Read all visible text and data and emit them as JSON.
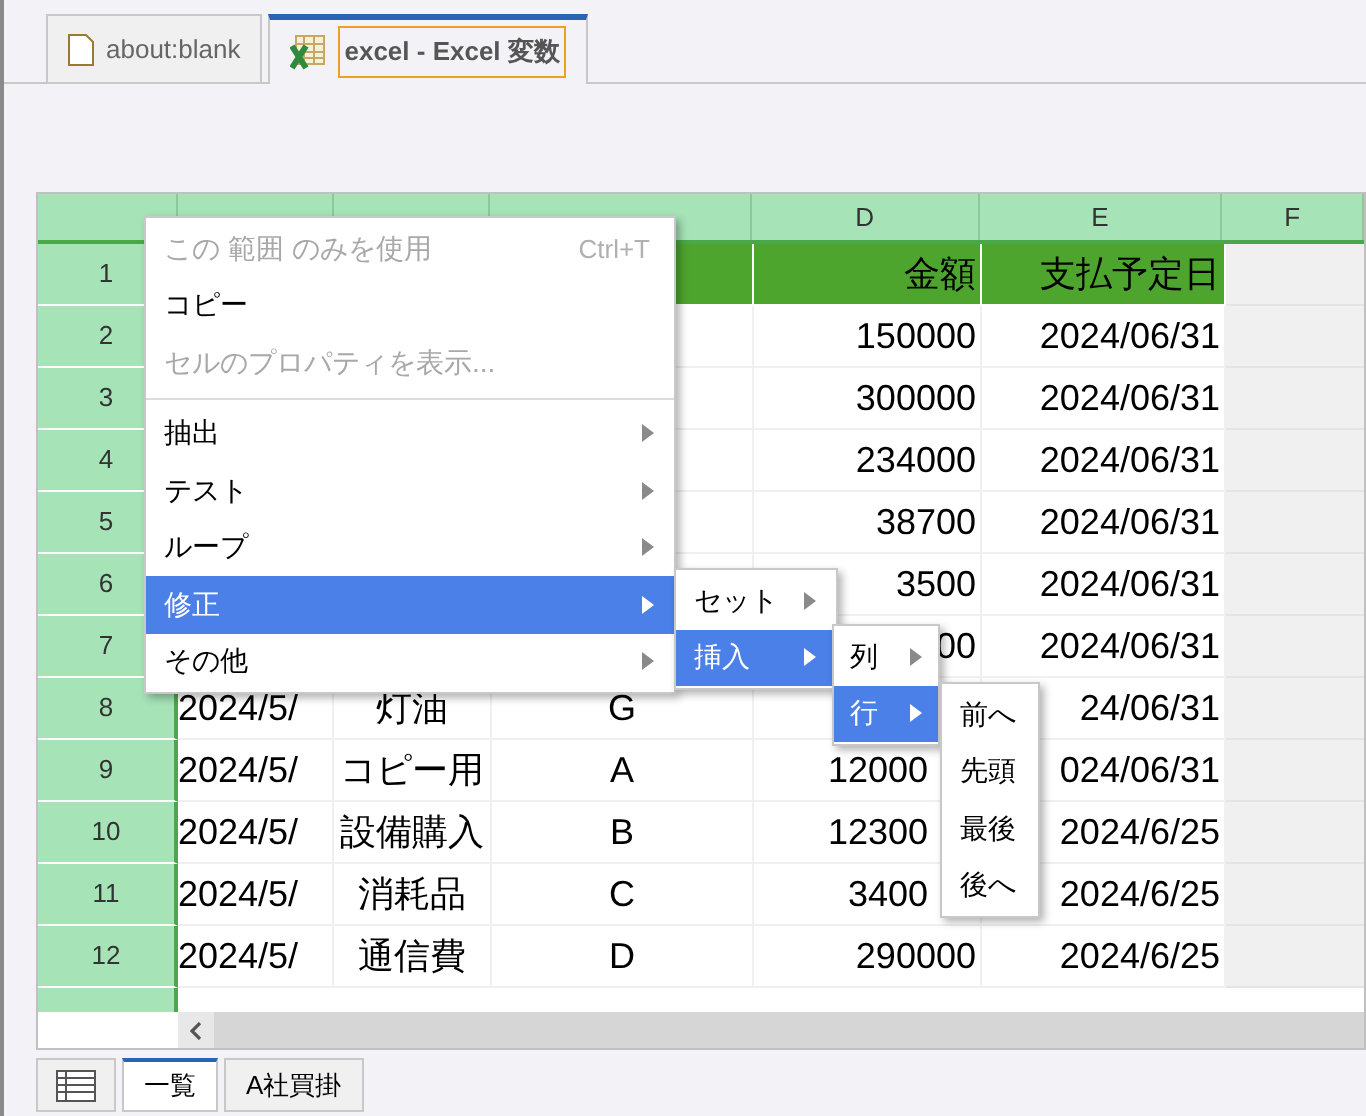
{
  "browser_tabs": [
    {
      "label": "about:blank",
      "selected": false,
      "kind": "page"
    },
    {
      "label": "excel - Excel 変数",
      "selected": true,
      "kind": "sheet"
    }
  ],
  "sheet": {
    "columns": [
      "",
      "",
      "",
      "D",
      "E",
      "F"
    ],
    "rows": [
      {
        "label": "1",
        "cells": [
          "",
          "",
          "",
          "金額",
          "支払予定日"
        ],
        "header": true
      },
      {
        "label": "2",
        "cells": [
          "",
          "",
          "",
          "150000",
          "2024/06/31"
        ]
      },
      {
        "label": "3",
        "cells": [
          "",
          "",
          "",
          "300000",
          "2024/06/31"
        ]
      },
      {
        "label": "4",
        "cells": [
          "",
          "",
          "",
          "234000",
          "2024/06/31"
        ]
      },
      {
        "label": "5",
        "cells": [
          "",
          "",
          "",
          "38700",
          "2024/06/31"
        ]
      },
      {
        "label": "6",
        "cells": [
          "",
          "",
          "",
          "3500",
          "2024/06/31"
        ]
      },
      {
        "label": "7",
        "cells": [
          "",
          "",
          "",
          "00",
          "2024/06/31"
        ]
      },
      {
        "label": "8",
        "cells": [
          "2024/5/",
          "灯油",
          "G",
          "",
          "24/06/31"
        ]
      },
      {
        "label": "9",
        "cells": [
          "2024/5/",
          "コピー用",
          "A",
          "12000",
          "024/06/31"
        ]
      },
      {
        "label": "10",
        "cells": [
          "2024/5/",
          "設備購入",
          "B",
          "12300",
          "2024/6/25"
        ]
      },
      {
        "label": "11",
        "cells": [
          "2024/5/",
          "消耗品",
          "C",
          "3400",
          "2024/6/25"
        ]
      },
      {
        "label": "12",
        "cells": [
          "2024/5/",
          "通信費",
          "D",
          "290000",
          "2024/6/25"
        ]
      }
    ]
  },
  "context_menu": [
    {
      "label": "この 範囲 のみを使用",
      "shortcut": "Ctrl+T",
      "disabled": true,
      "submenu": false,
      "selected": false,
      "separator_before": false
    },
    {
      "label": "コピー",
      "disabled": false,
      "submenu": false,
      "selected": false,
      "separator_before": false
    },
    {
      "label": "セルのプロパティを表示...",
      "disabled": true,
      "submenu": false,
      "selected": false,
      "separator_before": false
    },
    {
      "label": "抽出",
      "disabled": false,
      "submenu": true,
      "selected": false,
      "separator_before": true
    },
    {
      "label": "テスト",
      "disabled": false,
      "submenu": true,
      "selected": false,
      "separator_before": false
    },
    {
      "label": "ループ",
      "disabled": false,
      "submenu": true,
      "selected": false,
      "separator_before": false
    },
    {
      "label": "修正",
      "disabled": false,
      "submenu": true,
      "selected": true,
      "separator_before": false
    },
    {
      "label": "その他",
      "disabled": false,
      "submenu": true,
      "selected": false,
      "separator_before": false
    }
  ],
  "submenu_1": [
    {
      "label": "セット",
      "submenu": true,
      "selected": false
    },
    {
      "label": "挿入",
      "submenu": true,
      "selected": true
    }
  ],
  "submenu_2": [
    {
      "label": "列",
      "submenu": true,
      "selected": false
    },
    {
      "label": "行",
      "submenu": true,
      "selected": true
    }
  ],
  "submenu_3": [
    {
      "label": "前へ",
      "submenu": false,
      "selected": false
    },
    {
      "label": "先頭",
      "submenu": false,
      "selected": false
    },
    {
      "label": "最後",
      "submenu": false,
      "selected": false
    },
    {
      "label": "後へ",
      "submenu": false,
      "selected": false
    }
  ],
  "sheet_tabs": [
    {
      "label": "一覧",
      "selected": true
    },
    {
      "label": "A社買掛",
      "selected": false
    }
  ]
}
